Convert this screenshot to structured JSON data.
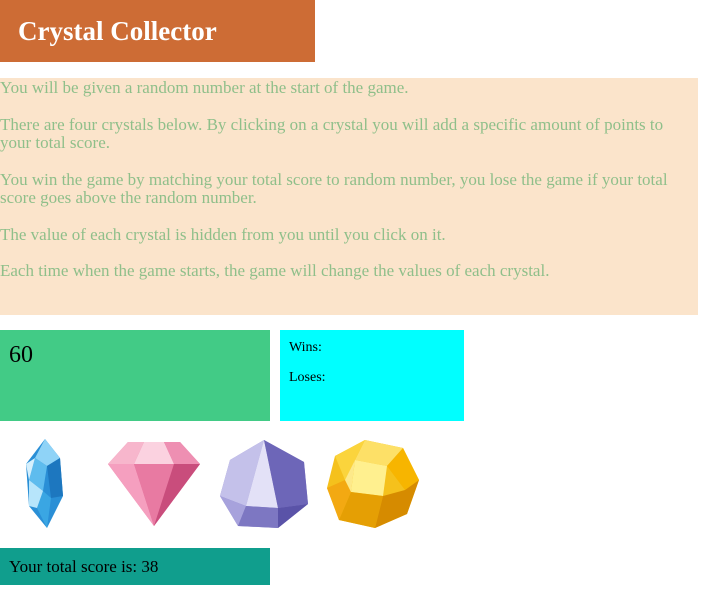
{
  "header": {
    "title": "Crystal Collector"
  },
  "instructions": {
    "paragraphs": [
      "You will be given a random number at the start of the game.",
      "There are four crystals below. By clicking on a crystal you will add a specific amount of points to your total score.",
      "You win the game by matching your total score to random number, you lose the game if your total score goes above the random number.",
      "The value of each crystal is hidden from you until you click on it.",
      "Each time when the game starts, the game will change the values of each crystal."
    ]
  },
  "game": {
    "random_number": "60",
    "wins_label": "Wins:",
    "loses_label": "Loses:",
    "total_score_text": "Your total score is: 38"
  },
  "crystals": [
    {
      "icon": "blue-crystal-icon",
      "color": "#3aa6e3"
    },
    {
      "icon": "pink-diamond-icon",
      "color": "#e46b96"
    },
    {
      "icon": "purple-gem-icon",
      "color": "#8d86cc"
    },
    {
      "icon": "yellow-gem-icon",
      "color": "#f5c11c"
    }
  ],
  "colors": {
    "title_bg": "#cd6c35",
    "instructions_bg": "#fbe4cb",
    "instructions_text": "#8fbf8a",
    "random_bg": "#42cb86",
    "score_bg": "#00ffff",
    "total_bg": "#109e8d"
  }
}
